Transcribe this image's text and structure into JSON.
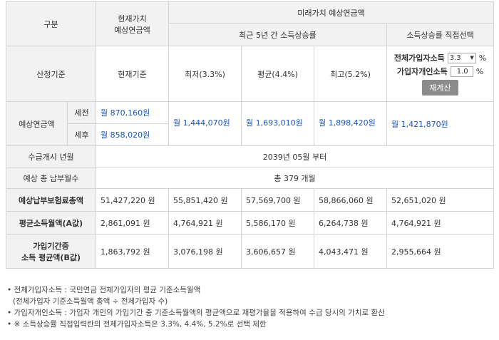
{
  "header": {
    "category": "구분",
    "present_value_line1": "현재가치",
    "present_value_line2": "예상연금액",
    "future_value": "미래가치 예상연금액",
    "recent_growth": "최근 5년 간 소득상승률",
    "direct_select": "소득상승률 직접선택"
  },
  "basis_row": {
    "label": "산정기준",
    "current": "현재기준",
    "low": "최저(3.3%)",
    "avg": "평균(4.4%)",
    "high": "최고(5.2%)",
    "all_label": "전체가입자소득",
    "all_value": "3.3",
    "personal_label": "가입자개인소득",
    "personal_value": "1.0",
    "percent": "%",
    "recalc_button": "재계산"
  },
  "expected_pension": {
    "label": "예상연금액",
    "pretax_label": "세전",
    "posttax_label": "세후",
    "pretax_current": "월 870,160원",
    "posttax_current": "월 858,020원",
    "low": "월 1,444,070원",
    "avg": "월 1,693,010원",
    "high": "월 1,898,420원",
    "custom": "월 1,421,870원"
  },
  "start_date": {
    "label": "수급개시 년월",
    "value": "2039년 05월 부터"
  },
  "total_months": {
    "label": "예상 총 납부월수",
    "value": "총 379 개월"
  },
  "total_premium": {
    "label": "예상납부보험료총액",
    "values": [
      "51,427,220 원",
      "55,851,420 원",
      "57,569,700 원",
      "58,866,060 원",
      "52,651,020 원"
    ]
  },
  "a_value": {
    "label": "평균소득월액(A값)",
    "values": [
      "2,861,091 원",
      "4,764,921 원",
      "5,586,170 원",
      "6,264,738 원",
      "4,764,921 원"
    ]
  },
  "b_value": {
    "label_line1": "가입기간중",
    "label_line2": "소득 평균액(B값)",
    "values": [
      "1,863,792 원",
      "3,076,198 원",
      "3,606,657 원",
      "4,043,471 원",
      "2,955,664 원"
    ]
  },
  "notes": [
    "• 전체가입자소득 : 국민연금 전체가입자의 평균 기준소득월액",
    "(전체가입자 기준소득월액 총액 ÷ 전체가입자 수)",
    "• 가입자개인소득 : 가입자 개인의 가입기간 중 기준소득월액의 평균액으로 재평가율을 적용하여 수급 당시의 가치로 환산",
    "• ※ 소득상승률 직접입력란의 전체가입자소득은 3.3%, 4.4%, 5.2%로 선택 제한"
  ]
}
